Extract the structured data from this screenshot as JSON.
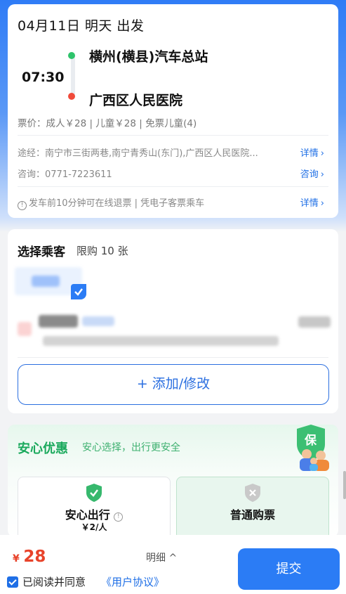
{
  "trip": {
    "date_line": "04月11日 明天 出发",
    "departure_time": "07:30",
    "from_station": "横州(横县)汽车总站",
    "to_station": "广西区人民医院",
    "price_line": "票价：成人￥28 | 儿童￥28 | 免票儿童(4)",
    "via_line": "途经：南宁市三街两巷,南宁青秀山(东门),广西区人民医院...",
    "via_link": "详情",
    "consult_line": "咨询：0771-7223611",
    "consult_link": "咨询",
    "notice_line": "发车前10分钟可在线退票 | 凭电子客票乘车",
    "notice_link": "详情",
    "chevron": "›"
  },
  "passengers": {
    "title": "选择乘客",
    "limit": "限购 10 张",
    "add_button": "+ 添加/修改"
  },
  "insurance": {
    "title": "安心优惠",
    "subtitle": "安心选择，出行更安全",
    "badge_char": "保",
    "option_safe_label": "安心出行",
    "option_safe_price": "￥2/人",
    "option_normal_label": "普通购票"
  },
  "footer": {
    "currency": "¥",
    "total": "28",
    "detail": "明细 ^",
    "agree_text": "已阅读并同意",
    "agreement_link": "《用户协议》",
    "submit": "提交"
  },
  "colors": {
    "accent": "#2b7cf5",
    "price": "#e8432a",
    "green": "#1aa95c"
  }
}
